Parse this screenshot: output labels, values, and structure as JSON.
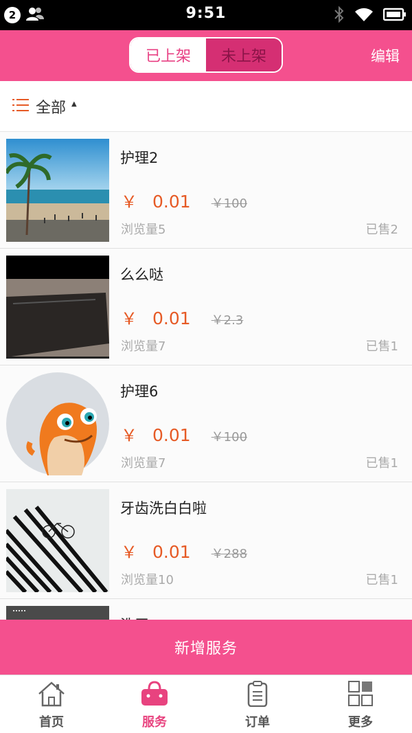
{
  "status_bar": {
    "notification_count": "2",
    "time": "9:51"
  },
  "header": {
    "segments": [
      "已上架",
      "未上架"
    ],
    "active_segment": 0,
    "edit_label": "编辑"
  },
  "filter": {
    "label": "全部"
  },
  "items": [
    {
      "title": "护理2",
      "currency": "￥",
      "price": "0.01",
      "original_price": "￥100",
      "views": "浏览量5",
      "sold": "已售2",
      "image": "beach-photo"
    },
    {
      "title": "么么哒",
      "currency": "￥",
      "price": "0.01",
      "original_price": "￥2.3",
      "views": "浏览量7",
      "sold": "已售1",
      "image": "phone-photo"
    },
    {
      "title": "护理6",
      "currency": "￥",
      "price": "0.01",
      "original_price": "￥100",
      "views": "浏览量7",
      "sold": "已售1",
      "image": "cartoon-avatar"
    },
    {
      "title": "牙齿洗白白啦",
      "currency": "￥",
      "price": "0.01",
      "original_price": "￥288",
      "views": "浏览量10",
      "sold": "已售1",
      "image": "stripes-bicycle"
    },
    {
      "title": "洗牙",
      "image": "dark-photo"
    }
  ],
  "add_button": {
    "label": "新增服务"
  },
  "tabbar": {
    "tabs": [
      {
        "label": "首页",
        "icon": "home-icon"
      },
      {
        "label": "服务",
        "icon": "basket-icon"
      },
      {
        "label": "订单",
        "icon": "clipboard-icon"
      },
      {
        "label": "更多",
        "icon": "grid-icon"
      }
    ],
    "active_tab": 1
  },
  "colors": {
    "brand_pink": "#f4508e",
    "price_orange": "#e65a25"
  }
}
